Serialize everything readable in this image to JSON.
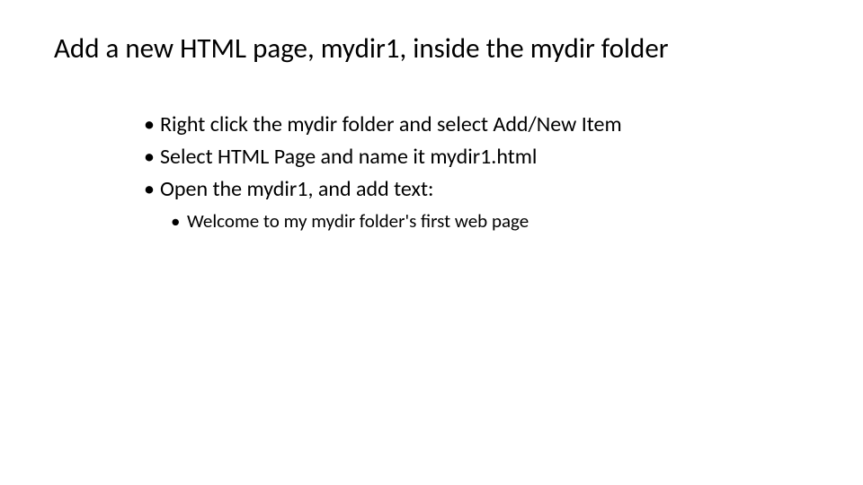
{
  "slide": {
    "title": "Add a new HTML page,  mydir1, inside the mydir folder",
    "bullets": [
      "Right click the mydir folder and select Add/New Item",
      "Select HTML Page and name it mydir1.html",
      "Open the mydir1, and add text:"
    ],
    "subBullets": [
      "Welcome to my mydir folder's first web page"
    ]
  }
}
